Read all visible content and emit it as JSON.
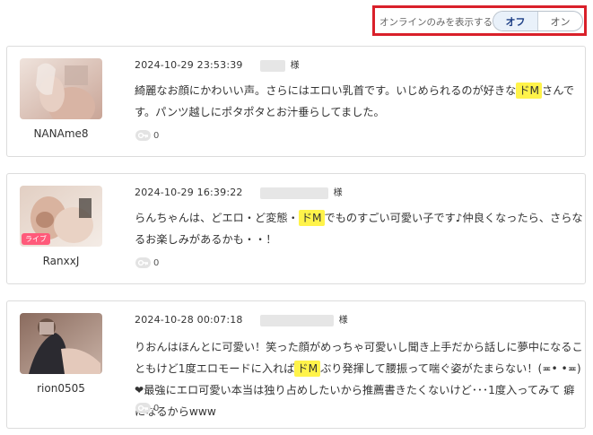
{
  "filter": {
    "label": "オンラインのみを表示する",
    "off_label": "オフ",
    "on_label": "オン",
    "selected": "オフ"
  },
  "reviews": [
    {
      "username": "NANAme8",
      "date": "2024-10-29 23:53:39",
      "honorific": "様",
      "text_before": "綺麗なお顔にかわいい声。さらにはエロい乳首です。いじめられるのが好きな",
      "highlight": "ドM",
      "text_after": "さんです。パンツ越しにポタポタとお汁垂らしてました。",
      "likes": "0"
    },
    {
      "username": "RanxxJ",
      "badge": "ライブ",
      "date": "2024-10-29 16:39:22",
      "honorific": "様",
      "text_before": "らんちゃんは、どエロ・ど変態・",
      "highlight": "ドM",
      "text_after": "でものすごい可愛い子です♪仲良くなったら、さらなるお楽しみがあるかも・・！",
      "likes": "0"
    },
    {
      "username": "rion0505",
      "date": "2024-10-28 00:07:18",
      "honorific": "様",
      "text_before": "りおんはほんとに可愛い！笑った顔がめっちゃ可愛いし聞き上手だから話しに夢中になることもけど1度エロモードに入れば",
      "highlight": "ドM",
      "text_after": "ぶり発揮して腰振って喘ぐ姿がたまらない！(≖• •≖)❤最強にエロ可愛い本当は独り占めしたいから推薦書きたくないけど･･･1度入ってみて 癖になるからwww",
      "likes": "0"
    }
  ],
  "colors": {
    "highlight": "#fff34a",
    "filter_border": "#d9202a",
    "toggle_active_bg": "#e9f1fa",
    "badge": "#ff5a7a"
  },
  "icons": {
    "like": "key-like-icon"
  }
}
